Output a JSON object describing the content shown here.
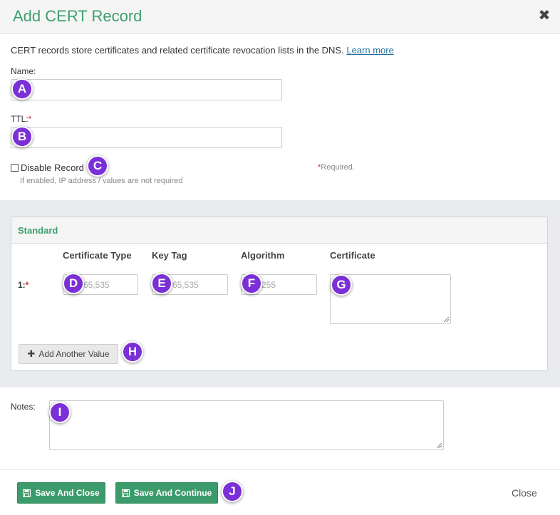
{
  "dialog": {
    "title": "Add CERT Record",
    "description": "CERT records store certificates and related certificate revocation lists in the DNS.",
    "learn_more": "Learn more"
  },
  "form": {
    "name_label": "Name:",
    "ttl_label": "TTL:",
    "required_star": "*",
    "disable_label": "Disable Record",
    "disable_hint": "If enabled, IP address / values are not required",
    "required_note": "Required.",
    "notes_label": "Notes:"
  },
  "standard": {
    "title": "Standard",
    "columns": [
      "Certificate Type",
      "Key Tag",
      "Algorithm",
      "Certificate"
    ],
    "row_label": "1:",
    "placeholders": {
      "certificate_type": "65,535",
      "key_tag": "65,535",
      "algorithm": "255"
    },
    "add_button": "Add Another Value"
  },
  "footer": {
    "save_close": "Save And Close",
    "save_continue": "Save And Continue",
    "close": "Close"
  },
  "badges": [
    "A",
    "B",
    "C",
    "D",
    "E",
    "F",
    "G",
    "H",
    "I",
    "J"
  ],
  "colors": {
    "accent_green": "#3d9f6e",
    "badge_purple": "#7b2fd6",
    "required_red": "#d9212c"
  }
}
